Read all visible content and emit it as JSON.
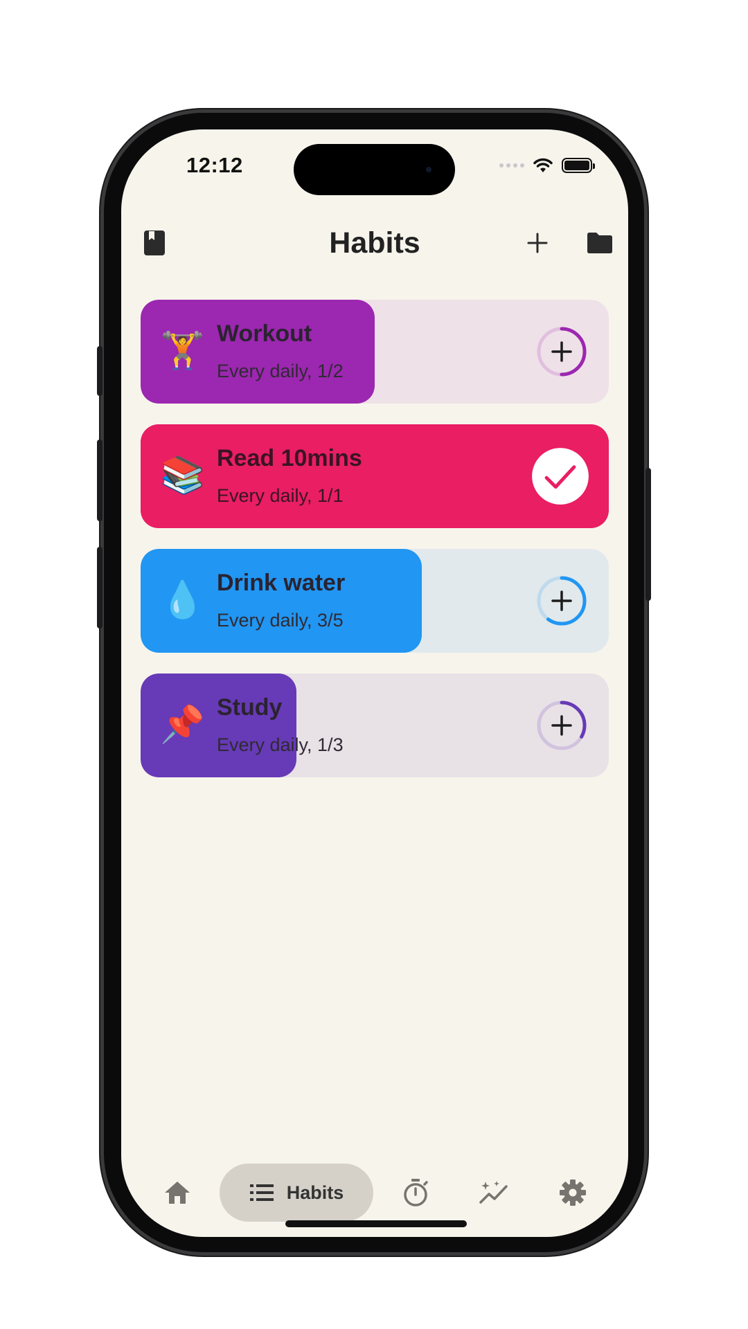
{
  "status_bar": {
    "time": "12:12"
  },
  "header": {
    "title": "Habits"
  },
  "habits": [
    {
      "emoji": "🏋",
      "name": "Workout",
      "subtitle": "Every daily, 1/2",
      "done": 1,
      "goal": 2,
      "progress": 0.5,
      "color": "#9c27b0",
      "track_color": "#efe1e8",
      "completed": false
    },
    {
      "emoji": "📚",
      "name": "Read 10mins",
      "subtitle": "Every daily, 1/1",
      "done": 1,
      "goal": 1,
      "progress": 1.0,
      "color": "#e91e63",
      "track_color": "#e91e63",
      "completed": true
    },
    {
      "emoji": "💧",
      "name": "Drink water",
      "subtitle": "Every daily, 3/5",
      "done": 3,
      "goal": 5,
      "progress": 0.6,
      "color": "#2196f3",
      "track_color": "#e1e9ec",
      "completed": false
    },
    {
      "emoji": "📌",
      "name": "Study",
      "subtitle": "Every daily, 1/3",
      "done": 1,
      "goal": 3,
      "progress": 0.333,
      "color": "#673ab7",
      "track_color": "#e8e2e7",
      "completed": false
    }
  ],
  "bottom_nav": {
    "items": [
      {
        "icon": "home-icon"
      },
      {
        "icon": "list-icon",
        "label": "Habits",
        "active": true
      },
      {
        "icon": "timer-icon"
      },
      {
        "icon": "trend-sparkle-icon"
      },
      {
        "icon": "gear-icon"
      }
    ]
  },
  "colors": {
    "background": "#f7f4ec",
    "active_pill": "#d5d1c9",
    "icon_gray": "#77736e"
  }
}
